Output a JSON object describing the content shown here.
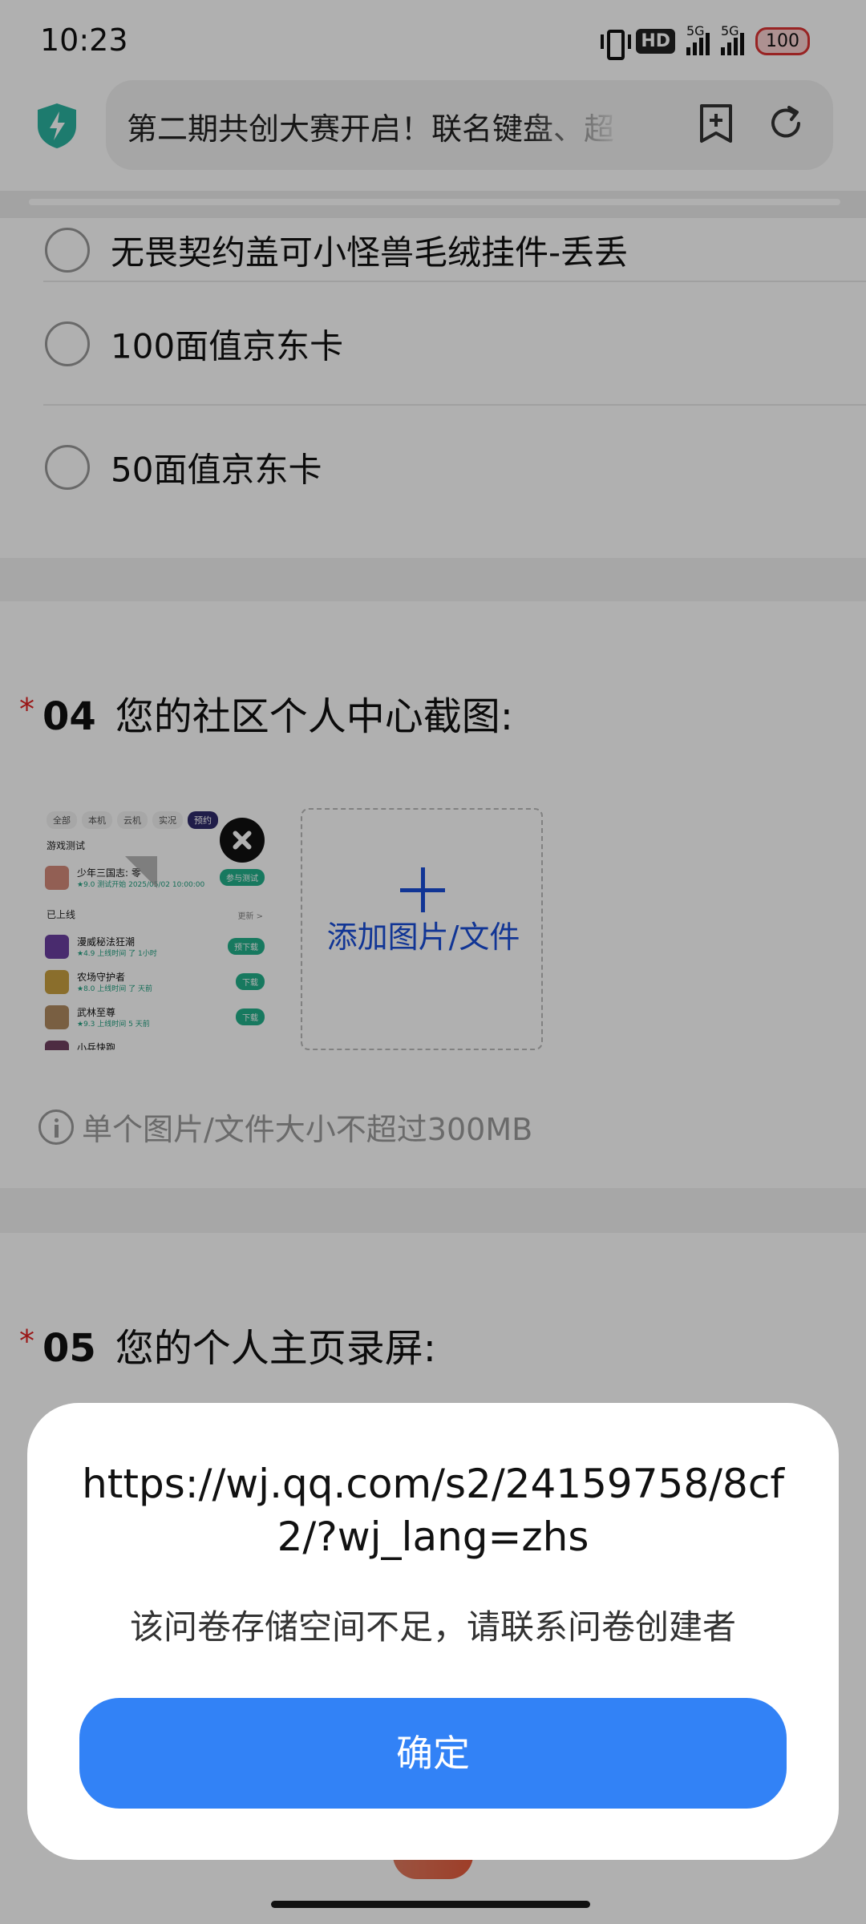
{
  "status_bar": {
    "time": "10:23",
    "hd_badge": "HD",
    "network_1": "5G",
    "network_2": "5G",
    "battery": "100"
  },
  "browser": {
    "url_text": "第二期共创大赛开启！联名键盘、超",
    "icons": [
      "shield-bolt-icon",
      "bookmark-add-icon",
      "reload-icon"
    ]
  },
  "options": [
    "无畏契约盖可小怪兽毛绒挂件-丢丢",
    "100面值京东卡",
    "50面值京东卡"
  ],
  "question_04": {
    "required_mark": "*",
    "number": "04",
    "title": "您的社区个人中心截图:"
  },
  "thumbnail": {
    "tabs": [
      "全部",
      "本机",
      "云机",
      "实况",
      "预约"
    ],
    "section_test": "游戏测试",
    "section_online": "已上线",
    "more": "更新 >",
    "rows": [
      {
        "name": "少年三国志: 零",
        "rating": "★9.0  测试开始 2025/05/02 10:00:00",
        "button": "参与测试"
      },
      {
        "name": "漫威秘法狂潮",
        "rating": "★4.9  上线时间 了 1小时",
        "button": "预下载"
      },
      {
        "name": "农场守护者",
        "rating": "★8.0  上线时间 了 天前",
        "button": "下载"
      },
      {
        "name": "武林至尊",
        "rating": "★9.3  上线时间 5 天前",
        "button": "下载"
      },
      {
        "name": "小兵快跑",
        "rating": "",
        "button": ""
      }
    ]
  },
  "upload": {
    "add_label": "添加图片/文件",
    "hint": "单个图片/文件大小不超过300MB"
  },
  "question_05": {
    "required_mark": "*",
    "number": "05",
    "title": "您的个人主页录屏:"
  },
  "dialog": {
    "title": "https://wj.qq.com/s2/24159758/8cf2/?wj_lang=zhs",
    "message": "该问卷存储空间不足，请联系问卷创建者",
    "confirm": "确定"
  },
  "colors": {
    "accent": "#3282f6",
    "link_blue": "#1a4ed8",
    "required_red": "#e02020",
    "shield_teal": "#2bb3a0"
  }
}
